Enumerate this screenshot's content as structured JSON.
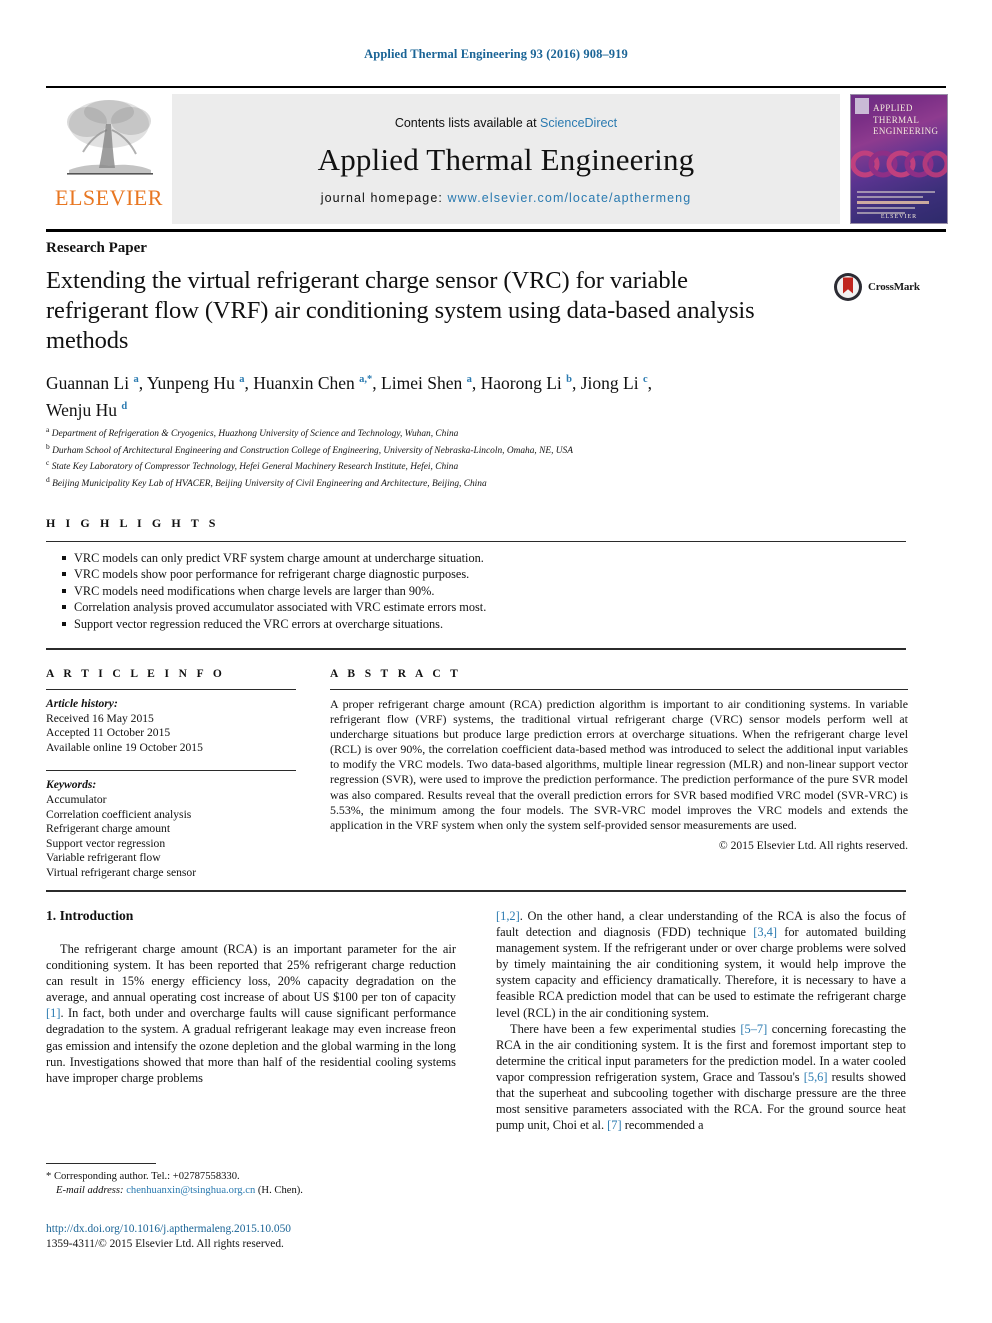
{
  "running_head": "Applied Thermal Engineering 93 (2016) 908–919",
  "masthead": {
    "publisher": "ELSEVIER",
    "contents_prefix": "Contents lists available at ",
    "contents_link": "ScienceDirect",
    "journal_title": "Applied Thermal Engineering",
    "homepage_prefix": "journal homepage: ",
    "homepage_url": "www.elsevier.com/locate/apthermeng",
    "cover": {
      "line1": "APPLIED",
      "line2": "THERMAL",
      "line3": "ENGINEERING",
      "brand": "ELSEVIER"
    }
  },
  "article": {
    "type": "Research Paper",
    "title": "Extending the virtual refrigerant charge sensor (VRC) for variable refrigerant flow (VRF) air conditioning system using data-based analysis methods",
    "crossmark_label": "CrossMark",
    "authors_line1": "Guannan Li a, Yunpeng Hu a, Huanxin Chen a,*, Limei Shen a, Haorong Li b, Jiong Li c,",
    "authors_line2": "Wenju Hu d",
    "affiliations": [
      {
        "marker": "a",
        "text": "Department of Refrigeration & Cryogenics, Huazhong University of Science and Technology, Wuhan, China"
      },
      {
        "marker": "b",
        "text": "Durham School of Architectural Engineering and Construction College of Engineering, University of Nebraska-Lincoln, Omaha, NE, USA"
      },
      {
        "marker": "c",
        "text": "State Key Laboratory of Compressor Technology, Hefei General Machinery Research Institute, Hefei, China"
      },
      {
        "marker": "d",
        "text": "Beijing Municipality Key Lab of HVACER, Beijing University of Civil Engineering and Architecture, Beijing, China"
      }
    ]
  },
  "highlights": {
    "heading": "H I G H L I G H T S",
    "items": [
      "VRC models can only predict VRF system charge amount at undercharge situation.",
      "VRC models show poor performance for refrigerant charge diagnostic purposes.",
      "VRC models need modifications when charge levels are larger than 90%.",
      "Correlation analysis proved accumulator associated with VRC estimate errors most.",
      "Support vector regression reduced the VRC errors at overcharge situations."
    ]
  },
  "article_info": {
    "heading": "A R T I C L E    I N F O",
    "history_label": "Article history:",
    "history": [
      "Received 16 May 2015",
      "Accepted 11 October 2015",
      "Available online 19 October 2015"
    ],
    "keywords_label": "Keywords:",
    "keywords": [
      "Accumulator",
      "Correlation coefficient analysis",
      "Refrigerant charge amount",
      "Support vector regression",
      "Variable refrigerant flow",
      "Virtual refrigerant charge sensor"
    ]
  },
  "abstract": {
    "heading": "A B S T R A C T",
    "text": "A proper refrigerant charge amount (RCA) prediction algorithm is important to air conditioning systems. In variable refrigerant flow (VRF) systems, the traditional virtual refrigerant charge (VRC) sensor models perform well at undercharge situations but produce large prediction errors at overcharge situations. When the refrigerant charge level (RCL) is over 90%, the correlation coefficient data-based method was introduced to select the additional input variables to modify the VRC models. Two data-based algorithms, multiple linear regression (MLR) and non-linear support vector regression (SVR), were used to improve the prediction performance. The prediction performance of the pure SVR model was also compared. Results reveal that the overall prediction errors for SVR based modified VRC model (SVR-VRC) is 5.53%, the minimum among the four models. The SVR-VRC model improves the VRC models and extends the application in the VRF system when only the system self-provided sensor measurements are used.",
    "rights": "© 2015 Elsevier Ltd. All rights reserved."
  },
  "body": {
    "section_title": "1.  Introduction",
    "left_paragraph_1_a": "The refrigerant charge amount (RCA) is an important parameter for the air conditioning system. It has been reported that 25% refrigerant charge reduction can result in 15% energy efficiency loss, 20% capacity degradation on the average, and annual operating cost increase of about US $100 per ton of capacity ",
    "left_paragraph_1_ref": "[1]",
    "left_paragraph_1_b": ". In fact, both under and overcharge faults will cause significant performance degradation to the system. A gradual refrigerant leakage may even increase freon gas emission and intensify the ozone depletion and the global warming in the long run. Investigations showed that more than half of the residential cooling systems have improper charge problems",
    "right_p1_ref1": "[1,2]",
    "right_p1_a": ". On the other hand, a clear understanding of the RCA is also the focus of fault detection and diagnosis (FDD) technique ",
    "right_p1_ref2": "[3,4]",
    "right_p1_b": " for automated building management system. If the refrigerant under or over charge problems were solved by timely maintaining the air conditioning system, it would help improve the system capacity and efficiency dramatically. Therefore, it is necessary to have a feasible RCA prediction model that can be used to estimate the refrigerant charge level (RCL) in the air conditioning system.",
    "right_p2_a": "There have been a few experimental studies ",
    "right_p2_ref1": "[5–7]",
    "right_p2_b": " concerning forecasting the RCA in the air conditioning system. It is the first and foremost important step to determine the critical input parameters for the prediction model. In a water cooled vapor compression refrigeration system, Grace and Tassou's ",
    "right_p2_ref2": "[5,6]",
    "right_p2_c": " results showed that the superheat and subcooling together with discharge pressure are the three most sensitive parameters associated with the RCA. For the ground source heat pump unit, Choi et al. ",
    "right_p2_ref3": "[7]",
    "right_p2_d": " recommended a"
  },
  "footnote": {
    "star": "*",
    "corresponding": " Corresponding author. Tel.: +02787558330.",
    "email_label": "E-mail address: ",
    "email": "chenhuanxin@tsinghua.org.cn",
    "email_suffix": " (H. Chen)."
  },
  "footer": {
    "doi": "http://dx.doi.org/10.1016/j.apthermaleng.2015.10.050",
    "issn_rights": "1359-4311/© 2015 Elsevier Ltd. All rights reserved."
  },
  "colors": {
    "link_blue": "#2a7ab0",
    "head_blue": "#1a6496",
    "elsevier_orange": "#E87722"
  }
}
